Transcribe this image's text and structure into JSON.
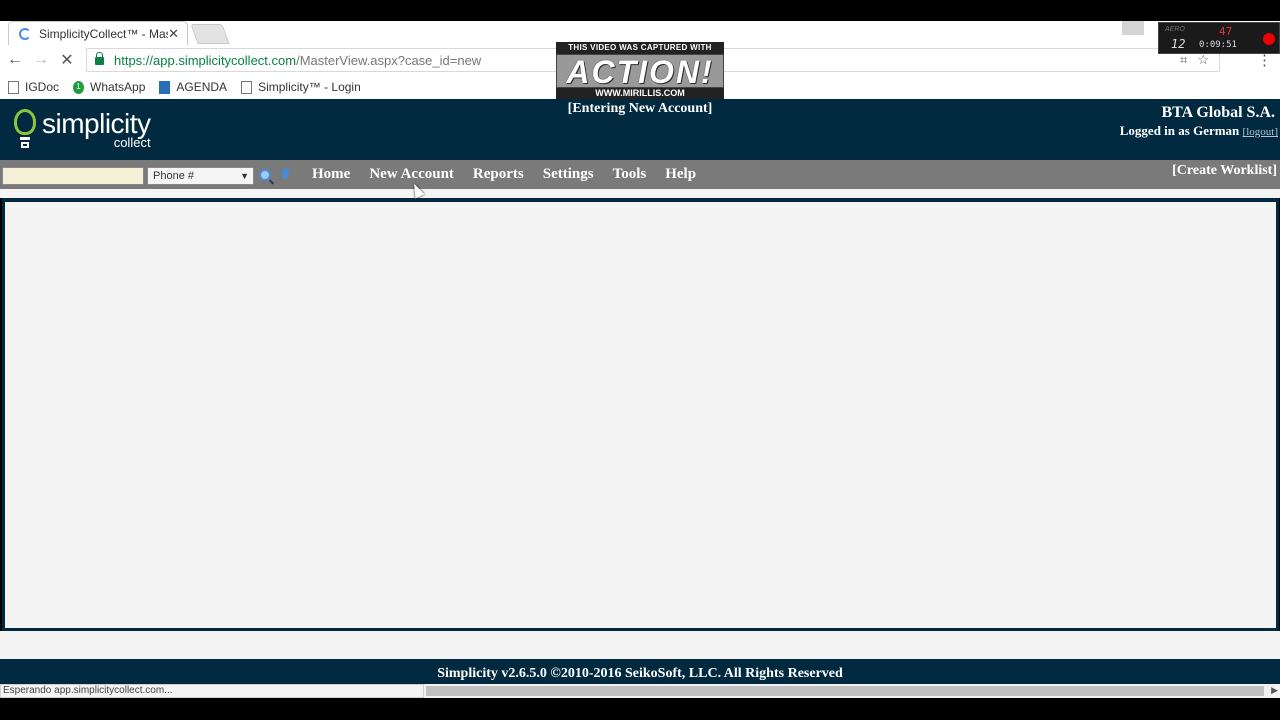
{
  "browser": {
    "tab_title": "SimplicityCollect™ - Mas",
    "tab_close": "✕",
    "url_scheme": "https://",
    "url_host": "app.simplicitycollect.com",
    "url_path": "/MasterView.aspx?case_id=new",
    "bookmarks": [
      {
        "label": "IGDoc",
        "icon": "page-icon"
      },
      {
        "label": "WhatsApp",
        "icon": "whatsapp-icon"
      },
      {
        "label": "AGENDA",
        "icon": "agenda-icon"
      },
      {
        "label": "Simplicity™ - Login",
        "icon": "page-icon"
      }
    ],
    "status_text": "Esperando app.simplicitycollect.com..."
  },
  "overlay": {
    "line1": "THIS VIDEO WAS CAPTURED WITH",
    "line2": "ACTION!",
    "line3": "WWW.MIRILLIS.COM"
  },
  "recorder": {
    "aero": "AERO",
    "fps": "47",
    "value": "12",
    "time": "0:09:51"
  },
  "app": {
    "logo_main": "simplicity",
    "logo_sub": "collect",
    "status": "[Entering New Account]",
    "company": "BTA Global S.A.",
    "logged_in_prefix": "Logged in as ",
    "user": "German",
    "logout": "[logout]",
    "search_placeholder": "",
    "search_type": "Phone #",
    "nav": {
      "home": "Home",
      "new_account": "New Account",
      "reports": "Reports",
      "settings": "Settings",
      "tools": "Tools",
      "help": "Help"
    },
    "create_worklist": "[Create Worklist]",
    "footer": "Simplicity v2.6.5.0 ©2010-2016 SeikoSoft, LLC. All Rights Reserved"
  }
}
